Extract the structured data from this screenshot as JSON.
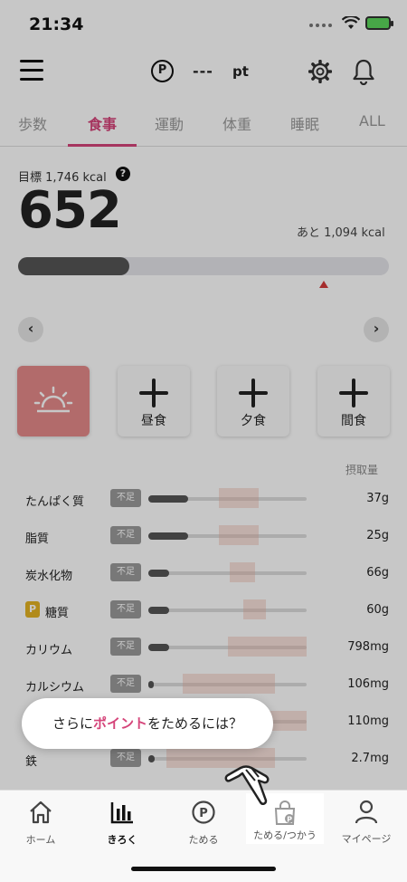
{
  "status": {
    "time": "21:34"
  },
  "header": {
    "points_value": "---",
    "points_unit": "pt",
    "points_icon": "P"
  },
  "tabs": [
    {
      "label": "歩数",
      "active": false
    },
    {
      "label": "食事",
      "active": true
    },
    {
      "label": "運動",
      "active": false
    },
    {
      "label": "体重",
      "active": false
    },
    {
      "label": "睡眠",
      "active": false
    },
    {
      "label": "ALL",
      "active": false
    }
  ],
  "goal": {
    "label": "目標 1,746 kcal",
    "help": "?",
    "current": "652",
    "remaining": "あと 1,094 kcal",
    "progress": 0.3
  },
  "meals": [
    {
      "label": "",
      "icon": "sunrise-icon",
      "active": true
    },
    {
      "label": "昼食",
      "icon": "plus-icon",
      "active": false
    },
    {
      "label": "夕食",
      "icon": "plus-icon",
      "active": false
    },
    {
      "label": "間食",
      "icon": "plus-icon",
      "active": false
    }
  ],
  "nutrients": {
    "header": "摂取量",
    "badge": "不足",
    "items": [
      {
        "name": "たんぱく質",
        "value": "37g",
        "level": 0.25
      },
      {
        "name": "脂質",
        "value": "25g",
        "level": 0.25
      },
      {
        "name": "炭水化物",
        "value": "66g",
        "level": 0.13
      },
      {
        "name": "糖質",
        "value": "60g",
        "level": 0.13,
        "point_icon": "P"
      },
      {
        "name": "カリウム",
        "value": "798mg",
        "level": 0.13
      },
      {
        "name": "カルシウム",
        "value": "106mg",
        "level": 0.03
      },
      {
        "name": "",
        "value": "110mg",
        "level": 0.04
      },
      {
        "name": "鉄",
        "value": "2.7mg",
        "level": 0.04
      }
    ]
  },
  "tooltip": {
    "before": "さらに",
    "highlight": "ポイント",
    "after": "をためるには？"
  },
  "bottom_nav": [
    {
      "label": "ホーム",
      "icon": "home-icon",
      "active": false
    },
    {
      "label": "きろく",
      "icon": "bar-chart-icon",
      "active": true
    },
    {
      "label": "ためる",
      "icon": "point-circle-icon",
      "active": false
    },
    {
      "label": "ためる/つかう",
      "icon": "shopping-bag-icon",
      "active": false
    },
    {
      "label": "マイページ",
      "icon": "user-icon",
      "active": false
    }
  ],
  "colors": {
    "accent": "#d5457a",
    "breakfast": "#e58a8a"
  }
}
